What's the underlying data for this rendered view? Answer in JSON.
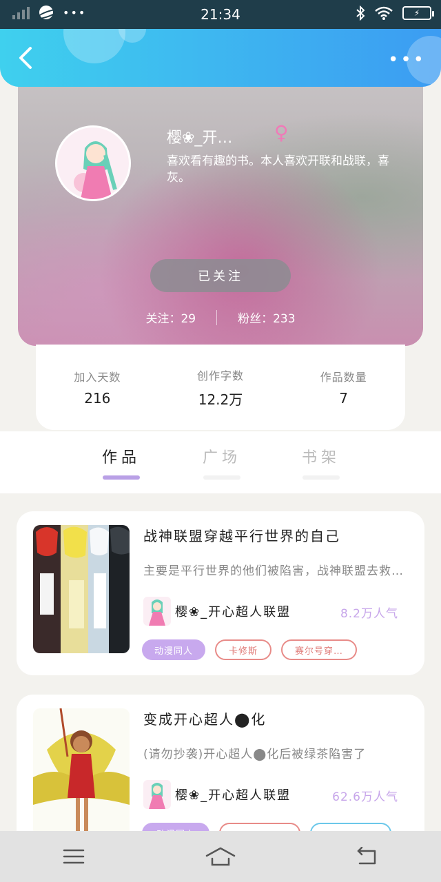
{
  "status_bar": {
    "time": "21:34",
    "battery_icon": "battery-charging-icon"
  },
  "header": {
    "back_icon": "back-arrow-icon",
    "more_icon": "more-dots-icon",
    "more_label": "•••"
  },
  "profile": {
    "name": "樱❀_开…",
    "gender_symbol": "♀",
    "bio": "喜欢看有趣的书。本人喜欢开联和战联，喜灰。",
    "follow_button": "已关注",
    "following": "关注：29",
    "followers": "粉丝：233"
  },
  "stats": [
    {
      "label": "加入天数",
      "value": "216"
    },
    {
      "label": "创作字数",
      "value": "12.2万"
    },
    {
      "label": "作品数量",
      "value": "7"
    }
  ],
  "tabs": [
    {
      "label": "作品",
      "active": true
    },
    {
      "label": "广场",
      "active": false
    },
    {
      "label": "书架",
      "active": false
    }
  ],
  "books": [
    {
      "title": "战神联盟穿越平行世界的自己",
      "desc": "主要是平行世界的他们被陷害，战神联盟去救他们",
      "author": "樱❀_开心超人联盟",
      "popularity": "8.2万人气",
      "tags": [
        "动漫同人",
        "卡修斯",
        "赛尔号穿…"
      ]
    },
    {
      "title": "变成开心超人⬤化",
      "desc": "(请勿抄袭)开心超人⬤化后被绿茶陷害了",
      "author": "樱❀_开心超人联盟",
      "popularity": "62.6万人气",
      "tags": [
        "动漫同人",
        "",
        ""
      ]
    }
  ],
  "navbar": {
    "menu_icon": "menu-icon",
    "home_icon": "home-icon",
    "back_icon": "return-icon"
  },
  "colors": {
    "accent": "#b9a0e6",
    "header_start": "#3fd0ee",
    "header_end": "#3c9cf2",
    "tag_red": "#e07b78",
    "tag_blue": "#6cc8ea"
  }
}
